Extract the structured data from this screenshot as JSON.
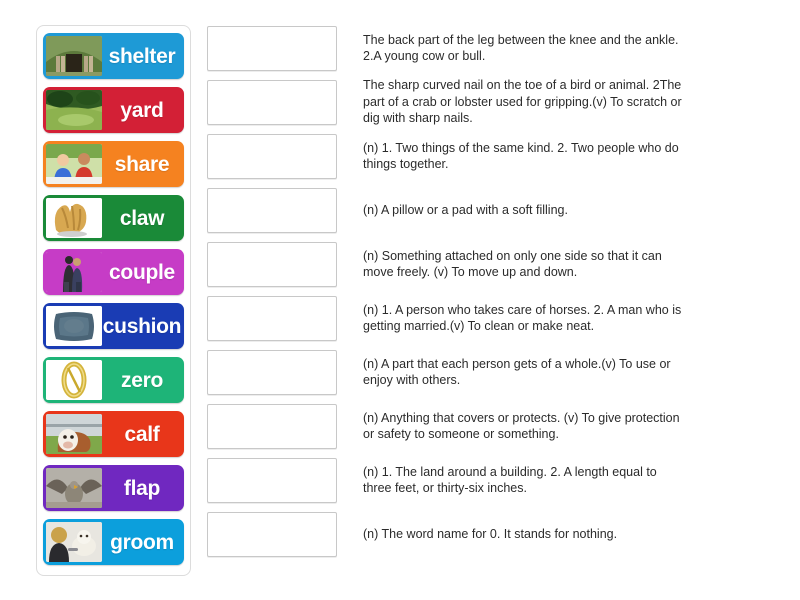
{
  "activity": {
    "type": "match-up",
    "word_count": 10,
    "definition_count": 10
  },
  "words": [
    {
      "label": "shelter",
      "color": "#1e9ad6",
      "image": "earth-shelter-hut"
    },
    {
      "label": "yard",
      "color": "#d32036",
      "image": "green-garden-yard"
    },
    {
      "label": "share",
      "color": "#f58220",
      "image": "two-children-sharing"
    },
    {
      "label": "claw",
      "color": "#1a8a38",
      "image": "crab-claw"
    },
    {
      "label": "couple",
      "color": "#c63cc6",
      "image": "couple-standing"
    },
    {
      "label": "cushion",
      "color": "#1a3cb4",
      "image": "blue-cushion-pillow"
    },
    {
      "label": "zero",
      "color": "#1eb478",
      "image": "golden-zero-digit"
    },
    {
      "label": "calf",
      "color": "#e8361a",
      "image": "brown-calf-cow"
    },
    {
      "label": "flap",
      "color": "#7028c0",
      "image": "bird-flapping-wings"
    },
    {
      "label": "groom",
      "color": "#0c9fdc",
      "image": "woman-grooming-dog"
    }
  ],
  "rows": [
    {
      "answer": "",
      "definition": "The back part of the leg between the knee and the ankle. 2.A young cow or bull."
    },
    {
      "answer": "",
      "definition": "The sharp curved nail on the toe of a bird or animal. 2The part of a crab or lobster used for gripping.(v) To scratch or dig with sharp nails."
    },
    {
      "answer": "",
      "definition": "(n) 1. Two things of the same kind. 2. Two people who do things together."
    },
    {
      "answer": "",
      "definition": "(n) A pillow or a pad with a soft filling."
    },
    {
      "answer": "",
      "definition": "(n) Something attached on only one side so that it can move freely. (v) To move up and down."
    },
    {
      "answer": "",
      "definition": "(n) 1. A person who takes care of horses. 2. A man who is getting married.(v) To clean or make neat."
    },
    {
      "answer": "",
      "definition": "(n) A part that each person gets of a whole.(v) To use or enjoy with others."
    },
    {
      "answer": "",
      "definition": "(n) Anything that covers or protects. (v) To give protection or safety to someone or something."
    },
    {
      "answer": "",
      "definition": "(n) 1. The land around a building. 2. A length equal to three feet, or thirty-six inches."
    },
    {
      "answer": "",
      "definition": "(n) The word name for 0. It stands for nothing."
    }
  ]
}
